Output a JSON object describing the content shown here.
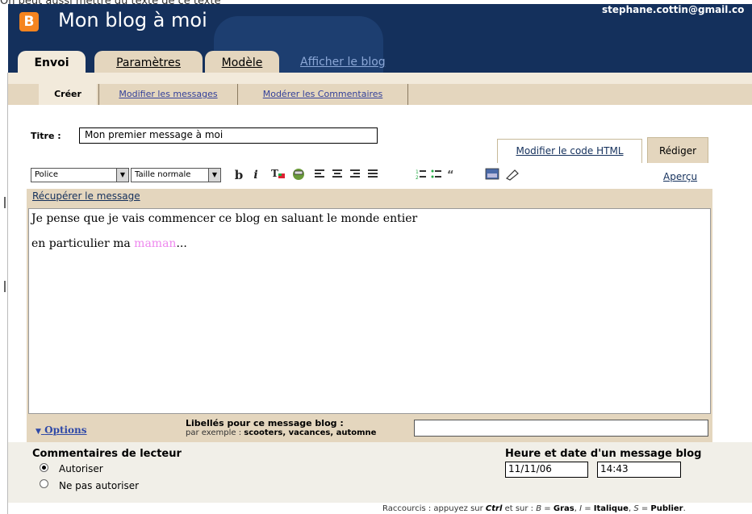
{
  "top_caption": "On peut aussi mettre du texte de ce texte",
  "header": {
    "logo_letter": "B",
    "blog_title": "Mon blog à moi",
    "user_email": "stephane.cottin@gmail.co",
    "tabs": [
      {
        "label": "Envoi",
        "active": true
      },
      {
        "label": "Paramètres",
        "active": false
      },
      {
        "label": "Modèle",
        "active": false
      }
    ],
    "view_blog_link": "Afficher le blog"
  },
  "subnav": {
    "items": [
      {
        "label": "Créer",
        "active": true
      },
      {
        "label": "Modifier les messages",
        "active": false
      },
      {
        "label": "Modérer les Commentaires",
        "active": false
      }
    ]
  },
  "post": {
    "title_label": "Titre :",
    "title_value": "Mon premier message à moi"
  },
  "mode_tabs": {
    "html_label": "Modifier le code HTML",
    "compose_label": "Rédiger"
  },
  "toolbar": {
    "font_select": "Police",
    "size_select": "Taille normale",
    "bold": "b",
    "italic": "i",
    "preview_link": "Aperçu",
    "recover_link": "Récupérer le message"
  },
  "editor": {
    "line1": "Je pense que je vais commencer ce blog en saluant le monde entier",
    "line2_prefix": "en particulier ma ",
    "line2_highlight": "maman",
    "line2_suffix": "..."
  },
  "options": {
    "link_label": "Options",
    "labels_title": "Libellés pour ce message blog :",
    "labels_example_prefix": "par exemple :",
    "labels_example_values": "scooters, vacances, automne",
    "labels_value": ""
  },
  "reader_comments": {
    "title": "Commentaires de lecteur",
    "allow": "Autoriser",
    "deny": "Ne pas autoriser",
    "selected": "allow"
  },
  "datetime": {
    "title": "Heure et date d'un message blog",
    "date": "11/11/06",
    "time": "14:43"
  },
  "shortcuts": {
    "prefix": "Raccourcis : appuyez sur",
    "ctrl": "Ctrl",
    "middle": "et sur :",
    "b_key": "B",
    "b_label": "Gras",
    "i_key": "I",
    "i_label": "Italique",
    "s_key": "S",
    "s_label": "Publier"
  },
  "colors": {
    "header_bg": "#14305c",
    "tab_bg": "#e4d6be",
    "active_tab_bg": "#f2eadb",
    "link": "#14305c",
    "highlight_text": "#ee88ee",
    "logo": "#f5841f"
  }
}
